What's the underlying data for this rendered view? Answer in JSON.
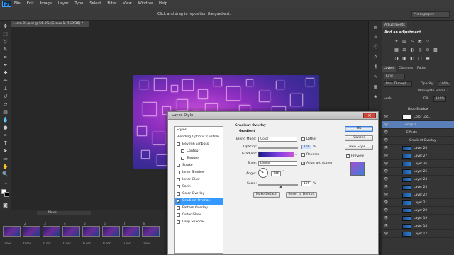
{
  "menu": {
    "logo": "Ps",
    "items": [
      "File",
      "Edit",
      "Image",
      "Layer",
      "Type",
      "Select",
      "Filter",
      "View",
      "Window",
      "Help"
    ]
  },
  "options_bar": {
    "hint": "Click and drag to reposition the gradient.",
    "workspace": "Photography"
  },
  "document": {
    "tab_label": "...am 01.psd @ 56.5% (Group 1, RGB/16) *"
  },
  "timeline": {
    "header": "Move",
    "clip_numbers": [
      "2",
      "3",
      "4",
      "5",
      "6",
      "7",
      "8"
    ],
    "clip_secs": [
      "0 sec.",
      "0 sec.",
      "0 sec.",
      "0 sec.",
      "0 sec.",
      "0 sec.",
      "0 sec.",
      "0 sec.",
      "0 sec."
    ]
  },
  "adjustments": {
    "tab": "Adjustments",
    "title": "Add an adjustment"
  },
  "layers": {
    "tabs": [
      "Layers",
      "Channels",
      "Paths"
    ],
    "kind": "Kind",
    "blend": "Pass Through",
    "opacity_label": "Opacity:",
    "opacity": "100%",
    "propagate": "Propagate Frame 1",
    "lock_label": "Lock:",
    "fill_label": "Fill:",
    "fill": "100%",
    "rows": [
      {
        "name": "Drop Shadow",
        "indent": true
      },
      {
        "name": "Color Loo...",
        "indent": false
      },
      {
        "name": "Group 1",
        "indent": false,
        "selected": true
      },
      {
        "name": "Effects",
        "indent": true
      },
      {
        "name": "Gradient Overlay",
        "indent": true
      },
      {
        "name": "Layer 28",
        "indent": false
      },
      {
        "name": "Layer 27",
        "indent": false
      },
      {
        "name": "Layer 26",
        "indent": false
      },
      {
        "name": "Layer 25",
        "indent": false
      },
      {
        "name": "Layer 24",
        "indent": false
      },
      {
        "name": "Layer 23",
        "indent": false
      },
      {
        "name": "Layer 22",
        "indent": false
      },
      {
        "name": "Layer 21",
        "indent": false
      },
      {
        "name": "Layer 20",
        "indent": false
      },
      {
        "name": "Layer 19",
        "indent": false
      },
      {
        "name": "Layer 18",
        "indent": false
      },
      {
        "name": "Layer 17",
        "indent": false
      }
    ]
  },
  "dialog": {
    "title": "Layer Style",
    "close": "✕",
    "styles_header": "Styles",
    "blending": "Blending Options: Custom",
    "style_items": [
      {
        "label": "Bevel & Emboss",
        "checked": false,
        "sub": false
      },
      {
        "label": "Contour",
        "checked": false,
        "sub": true
      },
      {
        "label": "Texture",
        "checked": false,
        "sub": true
      },
      {
        "label": "Stroke",
        "checked": false,
        "sub": false
      },
      {
        "label": "Inner Shadow",
        "checked": false,
        "sub": false
      },
      {
        "label": "Inner Glow",
        "checked": false,
        "sub": false
      },
      {
        "label": "Satin",
        "checked": false,
        "sub": false
      },
      {
        "label": "Color Overlay",
        "checked": false,
        "sub": false
      },
      {
        "label": "Gradient Overlay",
        "checked": true,
        "sub": false,
        "selected": true
      },
      {
        "label": "Pattern Overlay",
        "checked": false,
        "sub": false
      },
      {
        "label": "Outer Glow",
        "checked": false,
        "sub": false
      },
      {
        "label": "Drop Shadow",
        "checked": false,
        "sub": false
      }
    ],
    "section_title": "Gradient Overlay",
    "group_title": "Gradient",
    "blend_mode_label": "Blend Mode:",
    "blend_mode": "Color",
    "dither_label": "Dither",
    "opacity_label": "Opacity:",
    "opacity_value": "100",
    "opacity_unit": "%",
    "gradient_label": "Gradient:",
    "reverse_label": "Reverse",
    "style_label": "Style:",
    "style_value": "Linear",
    "align_label": "Align with Layer",
    "angle_label": "Angle:",
    "angle_value": "146",
    "angle_unit": "°",
    "scale_label": "Scale:",
    "scale_value": "100",
    "scale_unit": "%",
    "make_default": "Make Default",
    "reset_default": "Reset to Default",
    "ok": "OK",
    "cancel": "Cancel",
    "new_style": "New Style...",
    "preview_label": "Preview"
  }
}
